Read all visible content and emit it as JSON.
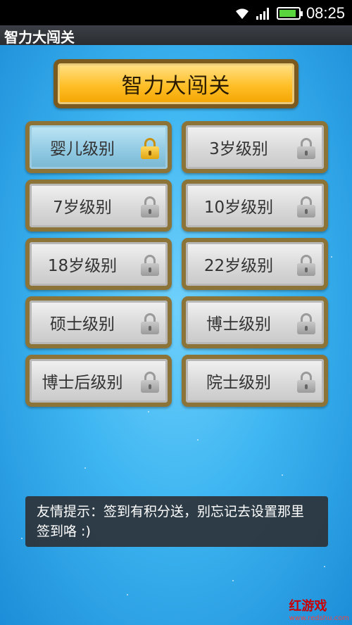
{
  "status_bar": {
    "time": "08:25",
    "battery_level": 0.9
  },
  "app_title": "智力大闯关",
  "banner_title": "智力大闯关",
  "levels": [
    {
      "label": "婴儿级别",
      "locked": true,
      "unlocked_style": true
    },
    {
      "label": "3岁级别",
      "locked": true,
      "unlocked_style": false
    },
    {
      "label": "7岁级别",
      "locked": true,
      "unlocked_style": false
    },
    {
      "label": "10岁级别",
      "locked": true,
      "unlocked_style": false
    },
    {
      "label": "18岁级别",
      "locked": true,
      "unlocked_style": false
    },
    {
      "label": "22岁级别",
      "locked": true,
      "unlocked_style": false
    },
    {
      "label": "硕士级别",
      "locked": true,
      "unlocked_style": false
    },
    {
      "label": "博士级别",
      "locked": true,
      "unlocked_style": false
    },
    {
      "label": "博士后级别",
      "locked": true,
      "unlocked_style": false
    },
    {
      "label": "院士级别",
      "locked": true,
      "unlocked_style": false
    }
  ],
  "toast": "友情提示：签到有积分送，别忘记去设置那里签到咯 :)",
  "watermark": {
    "brand": "红游戏",
    "url": "www.redshu.com"
  },
  "icons": [
    "wifi-icon",
    "signal-icon",
    "battery-icon",
    "lock-icon"
  ],
  "colors": {
    "background_blue": "#3eb6f1",
    "banner_gold": "#ffbf27",
    "frame_brown": "#8c7337"
  }
}
